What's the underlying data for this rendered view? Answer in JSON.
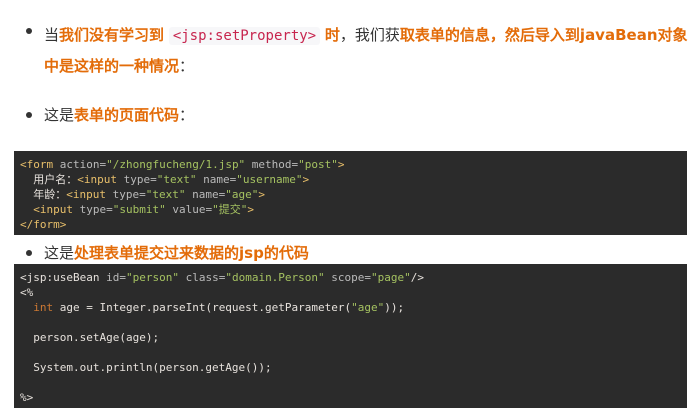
{
  "bullets": {
    "one": {
      "prefix": "当",
      "strong1": "我们没有学习到",
      "code": "<jsp:setProperty>",
      "strong2": "时",
      "mid": "，我们获",
      "strong3": "取表单的信息，然后导入到javaBean对象中是这样的一种情况",
      "suffix": "："
    },
    "two": {
      "prefix": "这是",
      "strong": "表单的页面代码",
      "suffix": "："
    },
    "three": {
      "prefix": "这是",
      "strong": "处理表单提交过来数据的jsp的代码"
    }
  },
  "code1": {
    "l1": {
      "t1": "<form",
      "a1": " action=",
      "s1": "\"/zhongfucheng/1.jsp\"",
      "a2": " method=",
      "s2": "\"post\"",
      "t2": ">"
    },
    "l2": {
      "label": "  用户名：",
      "t1": "<input",
      "a1": " type=",
      "s1": "\"text\"",
      "a2": " name=",
      "s2": "\"username\"",
      "t2": ">"
    },
    "l3": {
      "label": "  年龄：",
      "t1": "<input",
      "a1": " type=",
      "s1": "\"text\"",
      "a2": " name=",
      "s2": "\"age\"",
      "t2": ">"
    },
    "l4": {
      "t1": "  <input",
      "a1": " type=",
      "s1": "\"submit\"",
      "a2": " value=",
      "s2": "\"提交\"",
      "t2": ">"
    },
    "l5": {
      "t1": "</form>"
    }
  },
  "code2": {
    "l1": {
      "t1": "<jsp:useBean",
      "a1": " id=",
      "s1": "\"person\"",
      "a2": " class=",
      "s2": "\"domain.Person\"",
      "a3": " scope=",
      "s3": "\"page\"",
      "t2": "/>"
    },
    "l2": "<%",
    "l3": {
      "kw": "  int",
      "rest1": " age = Integer.parseInt(request.getParameter(",
      "s1": "\"age\"",
      "rest2": "));"
    },
    "l4": "",
    "l5": "  person.setAge(age);",
    "l6": "",
    "l7": "  System.out.println(person.getAge());",
    "l8": "",
    "l9": "%>"
  }
}
